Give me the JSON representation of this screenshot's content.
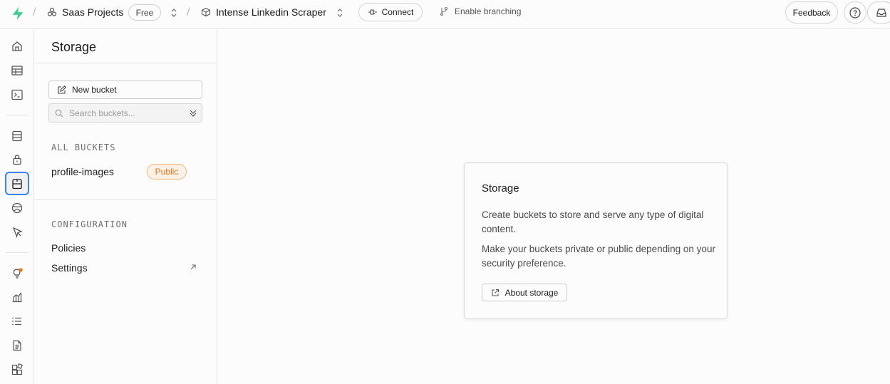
{
  "topbar": {
    "org_name": "Saas Projects",
    "plan": "Free",
    "project_name": "Intense Linkedin Scraper",
    "connect_label": "Connect",
    "branching_label": "Enable branching",
    "feedback_label": "Feedback",
    "separator": "/"
  },
  "colors": {
    "brand": "#3ecf8e",
    "active_outline": "#3b82f6",
    "badge_orange": "#d97521",
    "notification_dot": "#e07d2a"
  },
  "rail": {
    "icons": [
      "home-icon",
      "table-editor-icon",
      "sql-editor-icon",
      "database-icon",
      "auth-lock-icon",
      "storage-icon",
      "realtime-icon",
      "edge-functions-icon",
      "advisors-bulb-icon",
      "reports-icon",
      "logs-icon",
      "api-docs-icon",
      "integrations-icon"
    ],
    "active": "storage-icon"
  },
  "panel": {
    "title": "Storage",
    "new_bucket_label": "New bucket",
    "search_placeholder": "Search buckets...",
    "all_buckets_label": "ALL BUCKETS",
    "buckets": [
      {
        "name": "profile-images",
        "badge": "Public"
      }
    ],
    "configuration_label": "CONFIGURATION",
    "config_items": [
      "Policies",
      "Settings"
    ]
  },
  "card": {
    "title": "Storage",
    "text1": "Create buckets to store and serve any type of digital content.",
    "text2": "Make your buckets private or public depending on your security preference.",
    "button_label": "About storage"
  }
}
